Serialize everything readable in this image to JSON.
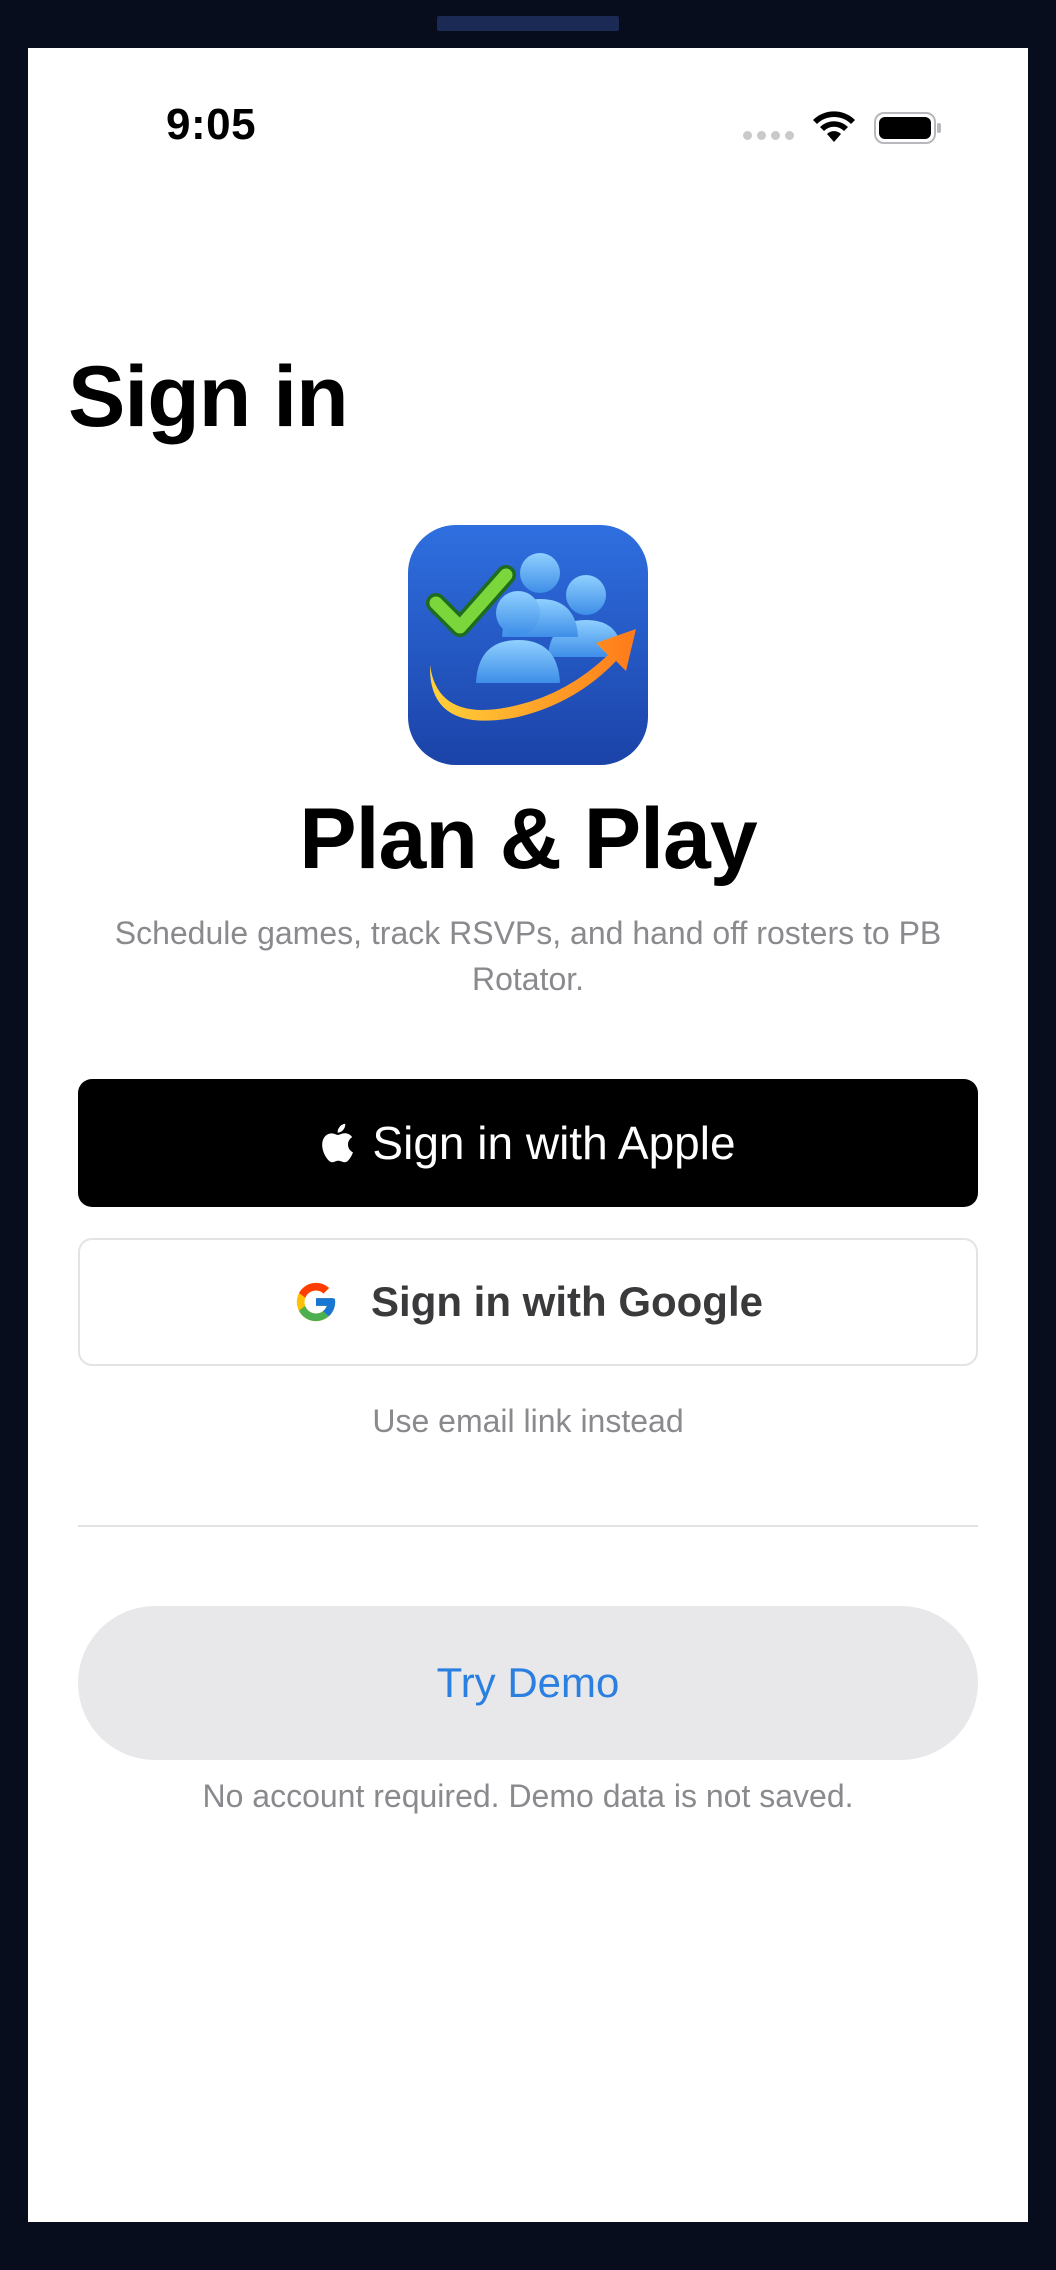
{
  "status_bar": {
    "time": "9:05"
  },
  "page": {
    "title": "Sign in"
  },
  "app": {
    "name": "Plan & Play",
    "tagline": "Schedule games, track RSVPs, and hand off rosters to PB Rotator.",
    "icon": "team-checkmark-arrow-app-icon"
  },
  "auth": {
    "apple_label": "Sign in with Apple",
    "google_label": "Sign in with Google",
    "email_link_label": "Use email link instead"
  },
  "demo": {
    "button_label": "Try Demo",
    "note": "No account required. Demo data is not saved."
  },
  "colors": {
    "background_frame": "#070d1c",
    "apple_button": "#000000",
    "demo_button_bg": "#e8e8ea",
    "demo_button_text": "#2a7fe0",
    "secondary_text": "#8a8a8e"
  }
}
